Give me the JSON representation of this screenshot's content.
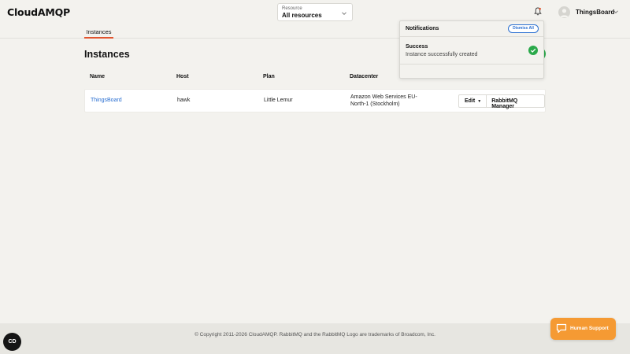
{
  "app": {
    "logo": "CloudAMQP"
  },
  "header": {
    "resource": {
      "label": "Resource",
      "value": "All resources"
    },
    "user": {
      "name": "ThingsBoard"
    }
  },
  "subnav": {
    "tab_label": "Instances"
  },
  "page": {
    "title": "Instances"
  },
  "table": {
    "columns": [
      "Name",
      "Host",
      "Plan",
      "Datacenter"
    ],
    "rows": [
      {
        "name": "ThingsBoard",
        "host": "hawk",
        "plan": "Little Lemur",
        "datacenter": "Amazon Web Services EU-North-1 (Stockholm)",
        "edit_label": "Edit",
        "manager_label": "RabbitMQ Manager"
      }
    ]
  },
  "notifications": {
    "title": "Notifications",
    "dismiss_label": "Dismiss All",
    "items": [
      {
        "title": "Success",
        "message": "Instance successfully created"
      }
    ]
  },
  "footer": {
    "text": "© Copyright 2011-2026 CloudAMQP. RabbitMQ and the RabbitMQ Logo are trademarks of Broadcom, Inc."
  },
  "support": {
    "label": "Human Support"
  },
  "badge": {
    "label": "CD"
  },
  "colors": {
    "accent": "#e2552f",
    "link": "#2a6fd1",
    "success": "#2aa94a",
    "support": "#f59a33"
  }
}
